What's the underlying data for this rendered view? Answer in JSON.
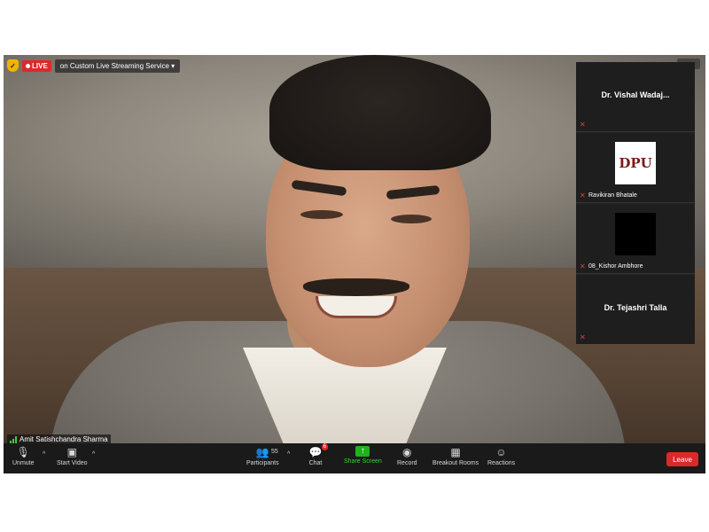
{
  "live_bar": {
    "live_label": "LIVE",
    "stream_text": "on Custom Live Streaming Service ▾"
  },
  "participants_panel": {
    "tiles": [
      {
        "name": "Dr. Vishal  Wadaj..."
      },
      {
        "name": "Ravikiran Bhatale",
        "logo_text": "DPU"
      },
      {
        "name": "08_Kishor Ambhore"
      },
      {
        "name": "Dr. Tejashri Talla"
      }
    ]
  },
  "active_speaker": {
    "name": "Amit Satishchandra Sharma"
  },
  "toolbar": {
    "unmute": "Unmute",
    "start_video": "Start Video",
    "participants": "Participants",
    "participants_count": "55",
    "chat": "Chat",
    "chat_badge": "6",
    "share_screen": "Share Screen",
    "record": "Record",
    "breakout_rooms": "Breakout Rooms",
    "reactions": "Reactions",
    "leave": "Leave"
  },
  "colors": {
    "live_red": "#e02828",
    "share_green": "#20b020",
    "leave_red": "#d92a2a",
    "toolbar_bg": "#1a1a1a"
  }
}
